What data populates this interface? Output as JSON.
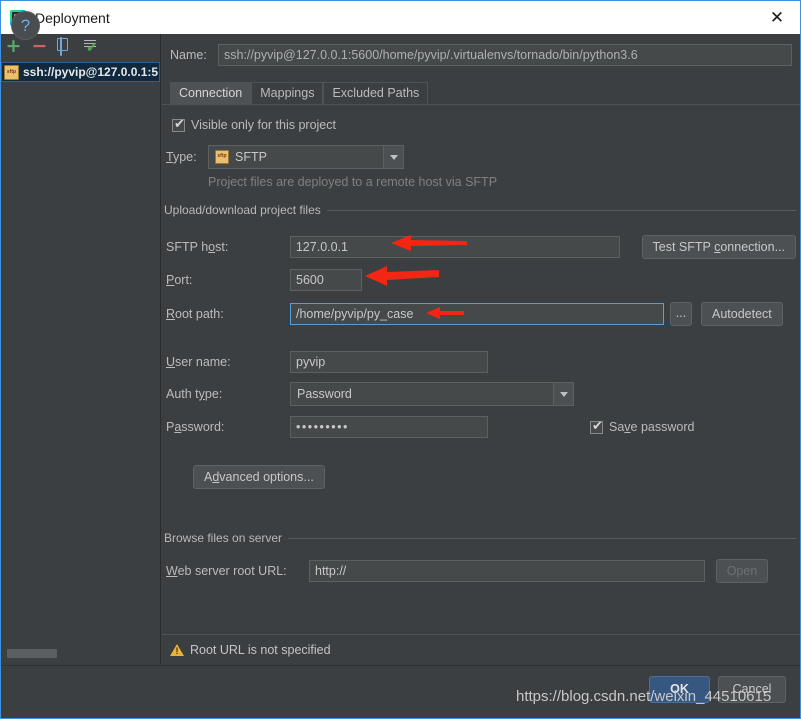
{
  "window": {
    "title": "Deployment",
    "app_icon": "pycharm-icon",
    "close_label": "✕"
  },
  "sidebar": {
    "toolbar": [
      {
        "name": "add",
        "glyph": "+"
      },
      {
        "name": "remove",
        "glyph": "−"
      },
      {
        "name": "copy",
        "glyph": ""
      },
      {
        "name": "use-as-default",
        "glyph": ""
      }
    ],
    "items": [
      {
        "label": "ssh://pyvip@127.0.0.1:5",
        "icon": "sftp-icon",
        "selected": true
      }
    ]
  },
  "form": {
    "name_label": "Name:",
    "name_value": "ssh://pyvip@127.0.0.1:5600/home/pyvip/.virtualenvs/tornado/bin/python3.6",
    "tabs": [
      {
        "label": "Connection",
        "active": true
      },
      {
        "label": "Mappings",
        "active": false
      },
      {
        "label": "Excluded Paths",
        "active": false
      }
    ],
    "visible_only_label": "Visible only for this project",
    "visible_only_checked": true,
    "type_label": "Type:",
    "type_value": "SFTP",
    "type_hint": "Project files are deployed to a remote host via SFTP",
    "upload_section_title": "Upload/download project files",
    "sftp_host_label": "SFTP host:",
    "sftp_host_value": "127.0.0.1",
    "test_connection_label": "Test SFTP connection...",
    "port_label": "Port:",
    "port_value": "5600",
    "root_path_label": "Root path:",
    "root_path_value": "/home/pyvip/py_case",
    "browse_label": "...",
    "autodetect_label": "Autodetect",
    "user_name_label": "User name:",
    "user_name_value": "pyvip",
    "auth_type_label": "Auth type:",
    "auth_type_value": "Password",
    "password_label": "Password:",
    "password_value": "•••••••••",
    "save_password_label": "Save password",
    "save_password_checked": true,
    "advanced_options_label": "Advanced options...",
    "browse_section_title": "Browse files on server",
    "web_root_label": "Web server root URL:",
    "web_root_value": "http://",
    "open_label": "Open"
  },
  "status": {
    "warning_text": "Root URL is not specified",
    "warning_icon": "warning-triangle-icon"
  },
  "footer": {
    "help_label": "?",
    "ok_label": "OK",
    "cancel_label": "Cancel"
  },
  "watermark": {
    "text": "https://blog.csdn.net/weixin_44510615"
  },
  "annotations": [
    {
      "name": "arrow-sftp-host"
    },
    {
      "name": "arrow-port"
    },
    {
      "name": "arrow-root-path"
    }
  ],
  "colors": {
    "accent": "#3f91e0",
    "panel": "#3c3f41",
    "field": "#45494a",
    "ok_button": "#365880",
    "arrow_red": "#f22613",
    "warning": "#e8b33c"
  }
}
